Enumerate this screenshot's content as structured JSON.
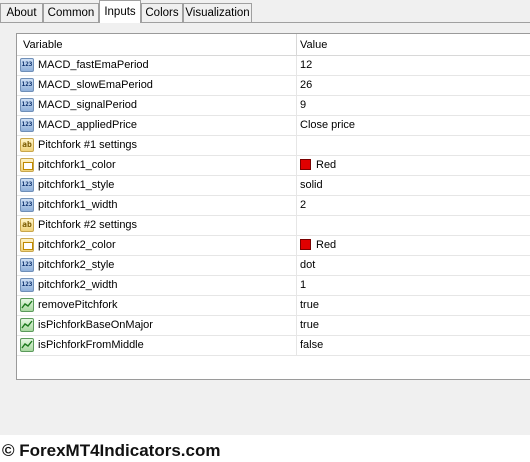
{
  "tabs": [
    {
      "label": "About"
    },
    {
      "label": "Common"
    },
    {
      "label": "Inputs",
      "active": true
    },
    {
      "label": "Colors"
    },
    {
      "label": "Visualization"
    }
  ],
  "grid": {
    "header": {
      "variable": "Variable",
      "value": "Value"
    },
    "rows": [
      {
        "icon": "numeric-icon",
        "icon_text": "123",
        "name": "MACD_fastEmaPeriod",
        "value": "12"
      },
      {
        "icon": "numeric-icon",
        "icon_text": "123",
        "name": "MACD_slowEmaPeriod",
        "value": "26"
      },
      {
        "icon": "numeric-icon",
        "icon_text": "123",
        "name": "MACD_signalPeriod",
        "value": "9"
      },
      {
        "icon": "numeric-icon",
        "icon_text": "123",
        "name": "MACD_appliedPrice",
        "value": "Close price"
      },
      {
        "icon": "string-icon",
        "icon_text": "ab",
        "name": "Pitchfork #1 settings",
        "value": ""
      },
      {
        "icon": "color-icon",
        "name": "pitchfork1_color",
        "value": "Red",
        "swatch": "#e00000"
      },
      {
        "icon": "numeric-icon",
        "icon_text": "123",
        "name": "pitchfork1_style",
        "value": "solid"
      },
      {
        "icon": "numeric-icon",
        "icon_text": "123",
        "name": "pitchfork1_width",
        "value": "2"
      },
      {
        "icon": "string-icon",
        "icon_text": "ab",
        "name": "Pitchfork #2 settings",
        "value": ""
      },
      {
        "icon": "color-icon",
        "name": "pitchfork2_color",
        "value": "Red",
        "swatch": "#e00000"
      },
      {
        "icon": "numeric-icon",
        "icon_text": "123",
        "name": "pitchfork2_style",
        "value": "dot"
      },
      {
        "icon": "numeric-icon",
        "icon_text": "123",
        "name": "pitchfork2_width",
        "value": "1"
      },
      {
        "icon": "boolean-icon",
        "name": "removePitchfork",
        "value": "true"
      },
      {
        "icon": "boolean-icon",
        "name": "isPichforkBaseOnMajor",
        "value": "true"
      },
      {
        "icon": "boolean-icon",
        "name": "isPichforkFromMiddle",
        "value": "false"
      }
    ]
  },
  "watermark": "© ForexMT4Indicators.com"
}
